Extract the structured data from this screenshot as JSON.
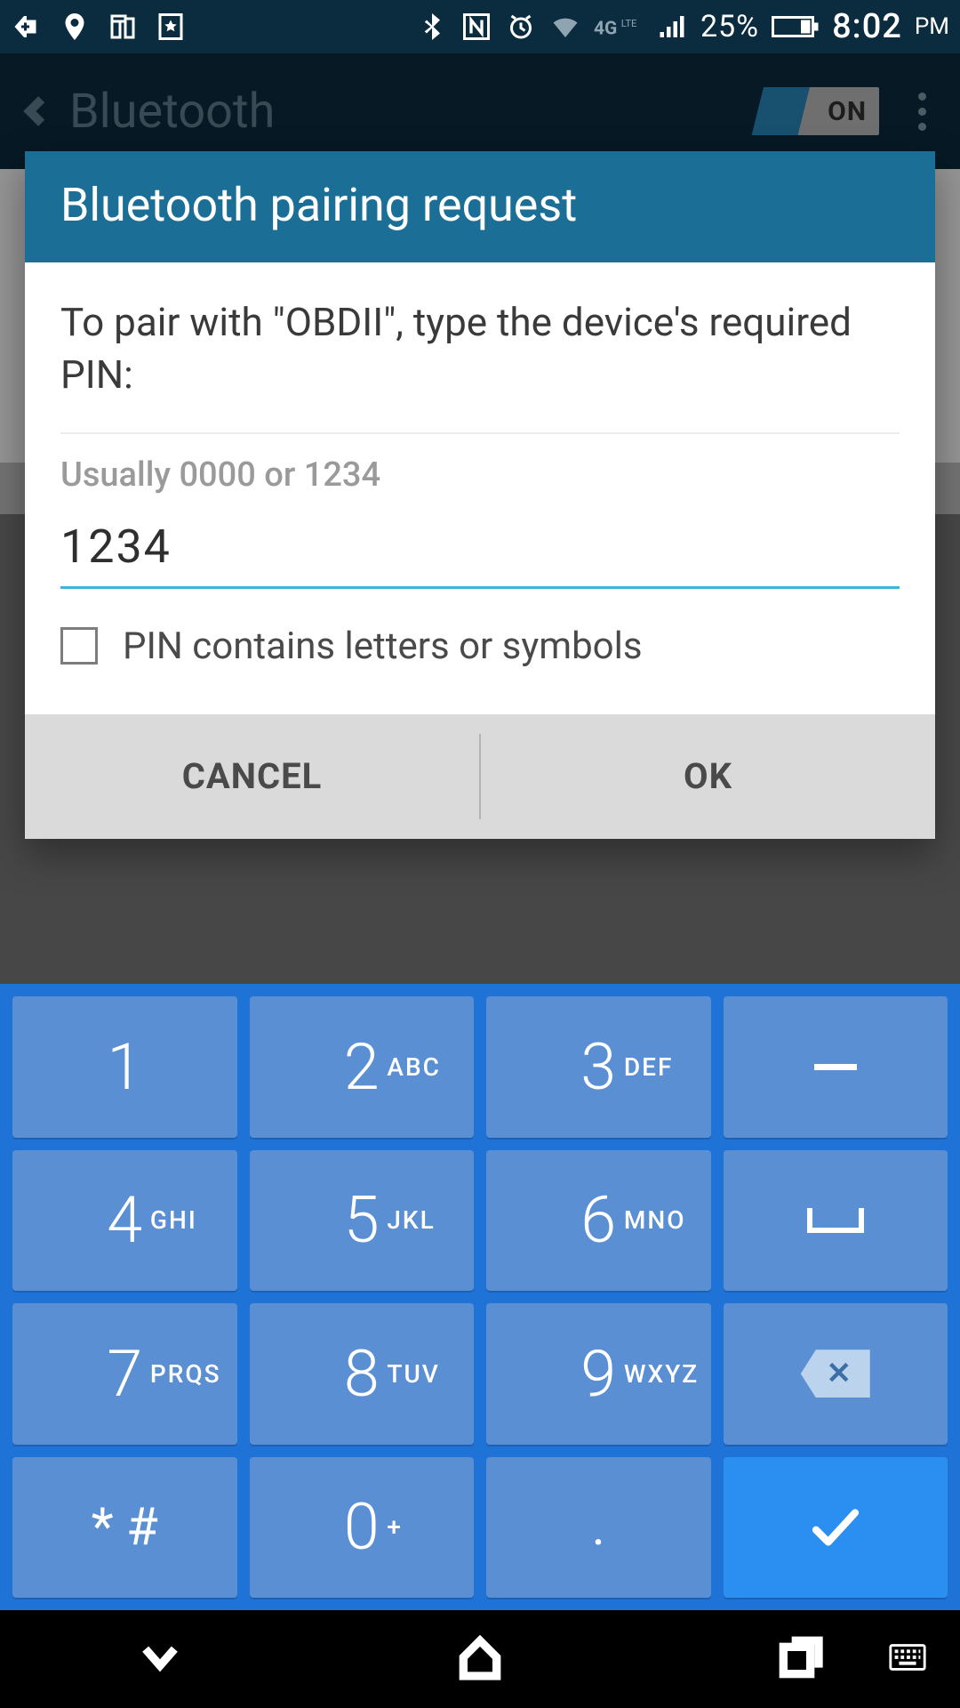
{
  "status": {
    "battery_pct": "25%",
    "time": "8:02",
    "ampm": "PM",
    "network": "4G LTE"
  },
  "appbar": {
    "title": "Bluetooth",
    "toggle_label": "ON"
  },
  "dialog": {
    "title": "Bluetooth pairing request",
    "message": "To pair with \"OBDII\", type the device's required PIN:",
    "hint": "Usually 0000 or 1234",
    "pin_value": "1234",
    "checkbox_label": "PIN contains letters or symbols",
    "cancel": "CANCEL",
    "ok": "OK"
  },
  "keypad": {
    "keys": [
      {
        "d": "1",
        "l": ""
      },
      {
        "d": "2",
        "l": "ABC"
      },
      {
        "d": "3",
        "l": "DEF"
      },
      {
        "d": "–",
        "l": "",
        "t": "dash"
      },
      {
        "d": "4",
        "l": "GHI"
      },
      {
        "d": "5",
        "l": "JKL"
      },
      {
        "d": "6",
        "l": "MNO"
      },
      {
        "d": "",
        "l": "",
        "t": "space"
      },
      {
        "d": "7",
        "l": "PRQS"
      },
      {
        "d": "8",
        "l": "TUV"
      },
      {
        "d": "9",
        "l": "WXYZ"
      },
      {
        "d": "",
        "l": "",
        "t": "bksp"
      },
      {
        "d": "* #",
        "l": ""
      },
      {
        "d": "0",
        "l": "+"
      },
      {
        "d": ".",
        "l": ""
      },
      {
        "d": "",
        "l": "",
        "t": "enter"
      }
    ]
  }
}
